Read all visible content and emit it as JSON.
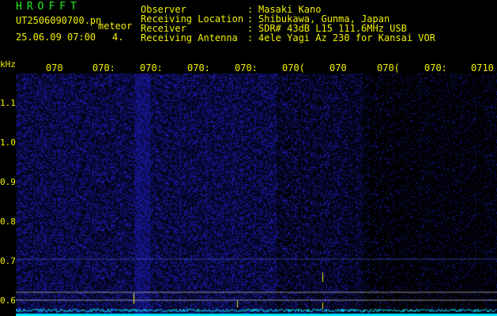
{
  "header": {
    "app_title": "HROFFT",
    "file_name": "UT2506090700.pn",
    "mode_label": "meteor",
    "datetime": "25.06.09 07:00",
    "count": "4."
  },
  "info": [
    {
      "label": "Observer",
      "value": "Masaki Kano"
    },
    {
      "label": "Receiving Location",
      "value": "Shibukawa, Gunma, Japan"
    },
    {
      "label": "Receiver",
      "value": "SDR# 43dB L15 111.6MHz USB"
    },
    {
      "label": "Receiving Antenna",
      "value": "4ele Yagi Az 230 for Kansai VOR"
    }
  ],
  "axis": {
    "y_unit": "kHz",
    "y_ticks": [
      "1.1",
      "1.0",
      "0.9",
      "0.8",
      "0.7",
      "0.6"
    ],
    "top_ticks": [
      "070",
      "070:",
      "070:",
      "070:",
      "070:",
      "070(",
      "070",
      "070(",
      "070:",
      "0710"
    ]
  },
  "colors": {
    "background": "#000000",
    "noise": "#2a2ab8",
    "text": "#f0f000",
    "title": "#22ee22",
    "trace": "#00e5ff"
  }
}
